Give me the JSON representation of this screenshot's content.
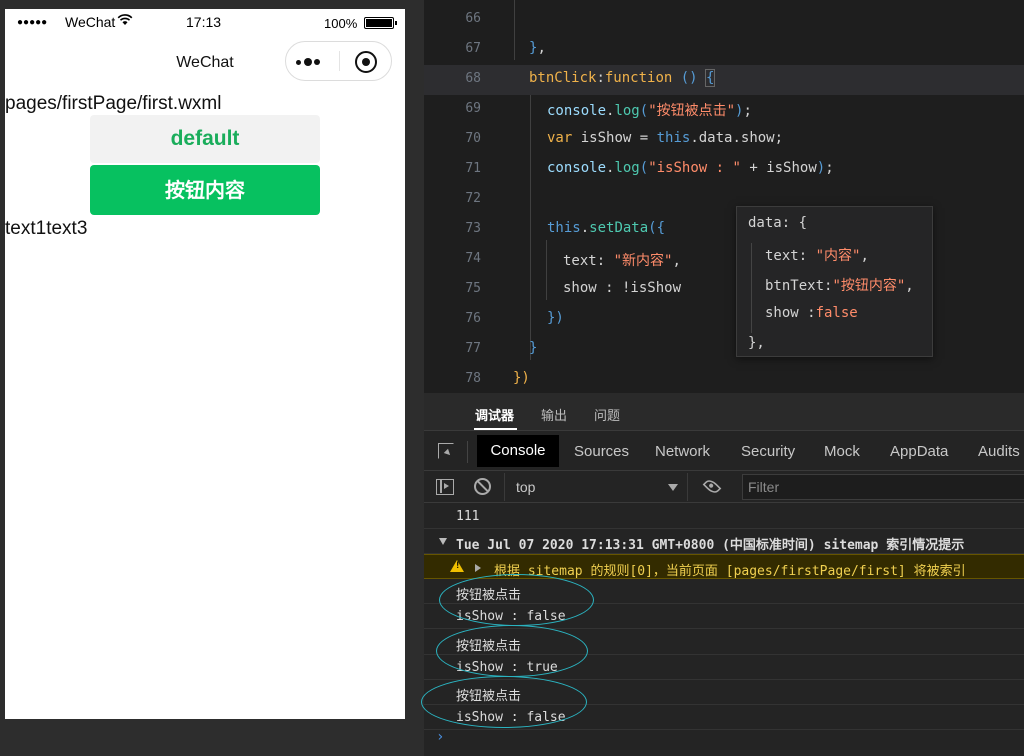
{
  "simulator": {
    "status_bar": {
      "signal": "●●●●●",
      "carrier": "WeChat",
      "wifi_icon": "wifi-icon",
      "time": "17:13",
      "battery_percent": "100%"
    },
    "nav": {
      "title": "WeChat",
      "menu_icon": "more-dots-icon",
      "home_icon": "record-circle-icon"
    },
    "page_path": "pages/firstPage/first.wxml",
    "buttons": {
      "default_label": "default",
      "primary_label": "按钮内容"
    },
    "text_output": "text1text3",
    "colors": {
      "primary_button": "#07c160",
      "default_text": "#1aad5b"
    }
  },
  "editor": {
    "lines": [
      {
        "n": "66"
      },
      {
        "n": "67"
      },
      {
        "n": "68"
      },
      {
        "n": "69"
      },
      {
        "n": "70"
      },
      {
        "n": "71"
      },
      {
        "n": "72"
      },
      {
        "n": "73"
      },
      {
        "n": "74"
      },
      {
        "n": "75"
      },
      {
        "n": "76"
      },
      {
        "n": "77"
      },
      {
        "n": "78"
      }
    ],
    "hover": {
      "l1": "data: {",
      "l2_key": "text: ",
      "l2_val": "\"内容\"",
      "l3_key": "btnText:",
      "l3_val": "\"按钮内容\"",
      "l4_key": "show :",
      "l4_val": "false",
      "l5": "},"
    }
  },
  "devtools": {
    "top_tabs": [
      "调试器",
      "输出",
      "问题"
    ],
    "panel_tabs": [
      "Console",
      "Sources",
      "Network",
      "Security",
      "Mock",
      "AppData",
      "Audits"
    ],
    "context": "top",
    "filter_placeholder": "Filter",
    "messages": [
      "111",
      "Tue Jul 07 2020 17:13:31 GMT+0800 (中国标准时间) sitemap 索引情况提示",
      "根据 sitemap 的规则[0]，当前页面 [pages/firstPage/first] 将被索引",
      "按钮被点击",
      "isShow : false",
      "按钮被点击",
      "isShow : true",
      "按钮被点击",
      "isShow : false"
    ],
    "prompt": "›"
  }
}
